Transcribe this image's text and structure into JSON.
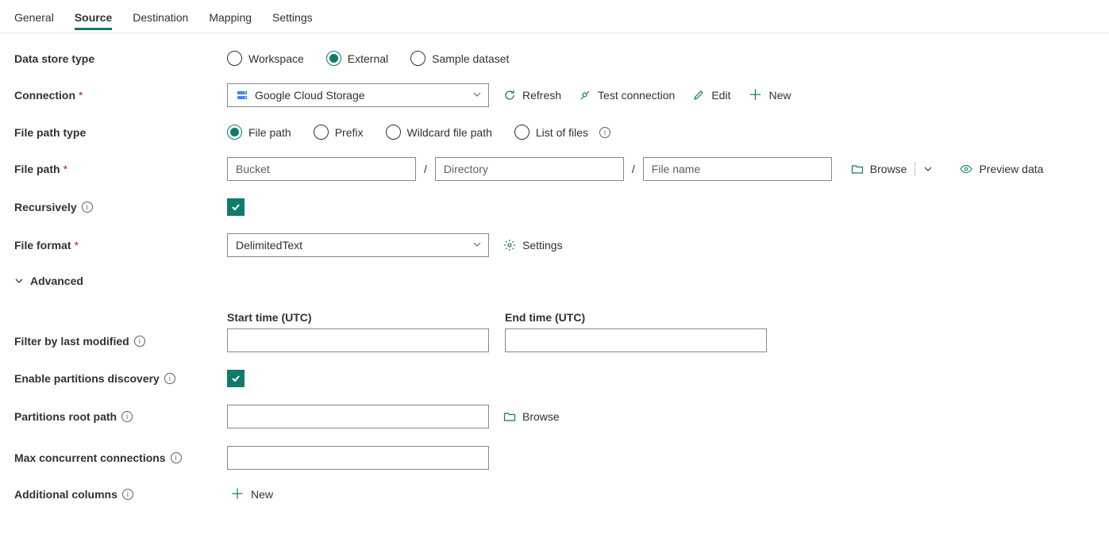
{
  "tabs": {
    "general": "General",
    "source": "Source",
    "destination": "Destination",
    "mapping": "Mapping",
    "settings": "Settings"
  },
  "labels": {
    "data_store_type": "Data store type",
    "connection": "Connection",
    "file_path_type": "File path type",
    "file_path": "File path",
    "recursively": "Recursively",
    "file_format": "File format",
    "advanced": "Advanced",
    "filter_by_last_modified": "Filter by last modified",
    "start_time": "Start time (UTC)",
    "end_time": "End time (UTC)",
    "enable_partitions_discovery": "Enable partitions discovery",
    "partitions_root_path": "Partitions root path",
    "max_concurrent_connections": "Max concurrent connections",
    "additional_columns": "Additional columns"
  },
  "data_store_type": {
    "workspace": "Workspace",
    "external": "External",
    "sample_dataset": "Sample dataset",
    "selected": "external"
  },
  "connection": {
    "value": "Google Cloud Storage",
    "actions": {
      "refresh": "Refresh",
      "test": "Test connection",
      "edit": "Edit",
      "new": "New"
    }
  },
  "file_path_type": {
    "file_path": "File path",
    "prefix": "Prefix",
    "wildcard": "Wildcard file path",
    "list_of_files": "List of files",
    "selected": "file_path"
  },
  "file_path": {
    "bucket_ph": "Bucket",
    "directory_ph": "Directory",
    "filename_ph": "File name",
    "browse": "Browse",
    "preview_data": "Preview data"
  },
  "file_format": {
    "value": "DelimitedText",
    "settings": "Settings"
  },
  "partition": {
    "browse": "Browse"
  },
  "additional_columns": {
    "new": "New"
  }
}
